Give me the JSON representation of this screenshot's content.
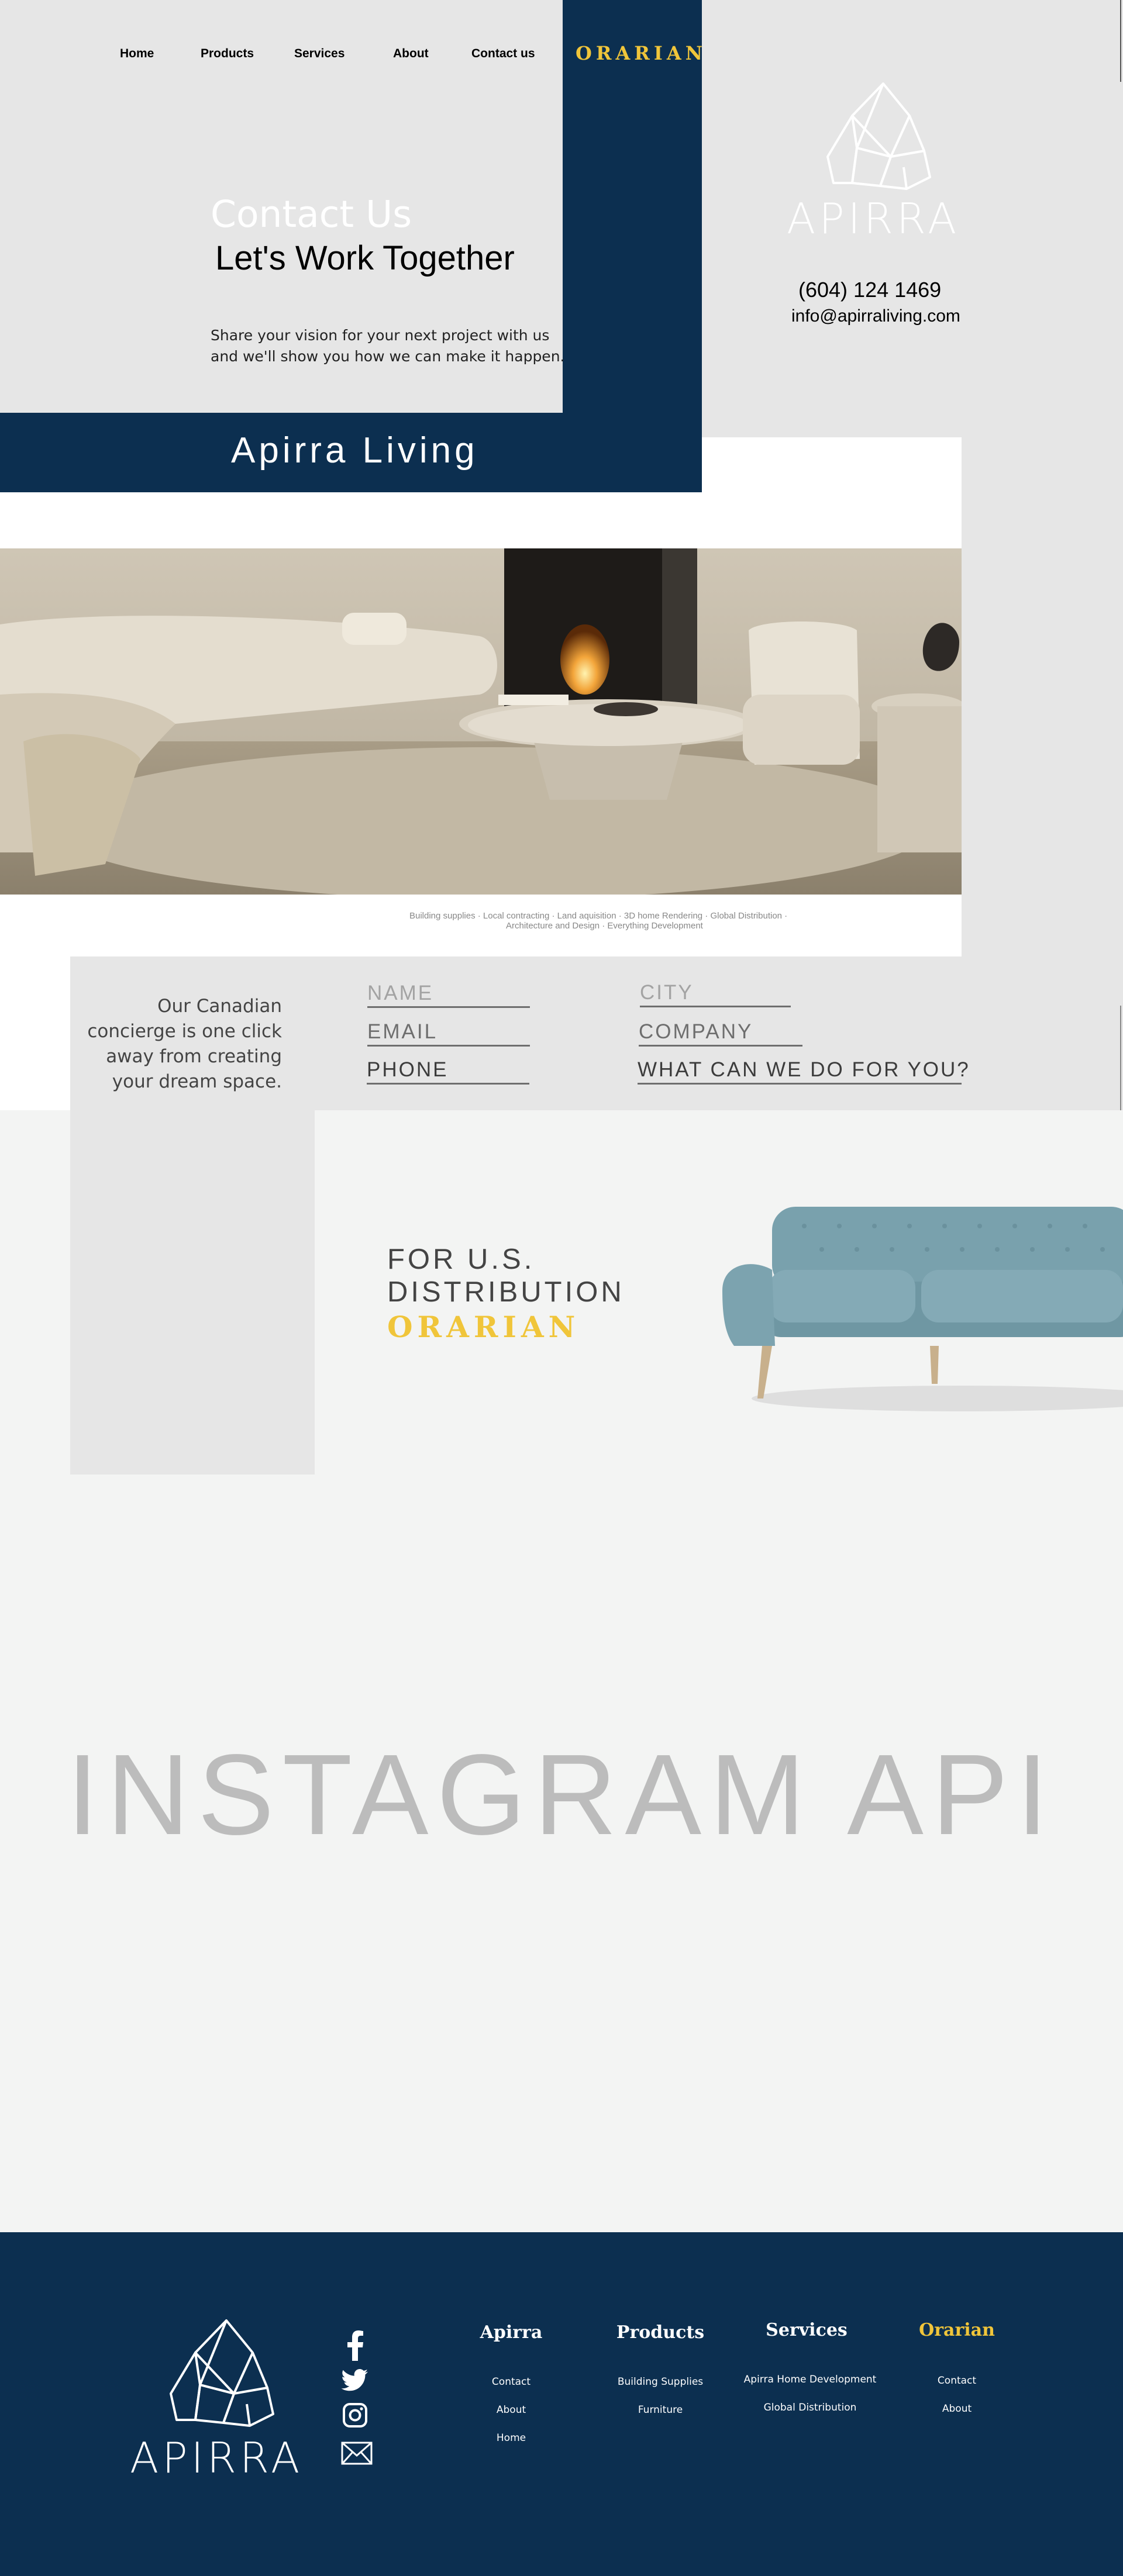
{
  "nav": {
    "items": [
      "Home",
      "Products",
      "Services",
      "About",
      "Contact us"
    ],
    "brand": "ORARIAN"
  },
  "logo": {
    "text": "APIRRA"
  },
  "hero": {
    "eyebrow": "Contact Us",
    "title": "Let's Work Together",
    "subtitle_line1": "Share your vision for your next project with us",
    "subtitle_line2": "and we'll show you how we can make it happen.",
    "band_title": "Apirra Living"
  },
  "contact": {
    "phone": "(604) 124 1469",
    "email": "info@apirraliving.com"
  },
  "services_caption": {
    "line1": "Building supplies · Local contracting · Land aquisition · 3D home Rendering · Global Distribution ·",
    "line2": "Architecture and Design · Everything Development"
  },
  "concierge": {
    "line1": "Our Canadian",
    "line2": "concierge is one click",
    "line3": "away from creating",
    "line4": "your dream space."
  },
  "form": {
    "name": "NAME",
    "city": "CITY",
    "email": "EMAIL",
    "company": "COMPANY",
    "phone": "PHONE",
    "what": "WHAT CAN WE DO FOR YOU?"
  },
  "distribution": {
    "line1": "FOR U.S.",
    "line2": "DISTRIBUTION",
    "brand": "ORARIAN"
  },
  "instagram": {
    "text": "INSTAGRAM API"
  },
  "footer": {
    "columns": [
      {
        "heading": "Apirra",
        "links": [
          "Contact",
          "About",
          "Home"
        ]
      },
      {
        "heading": "Products",
        "links": [
          "Building Supplies",
          "Furniture"
        ]
      },
      {
        "heading": "Services",
        "links": [
          "Apirra Home Development",
          "Global Distribution"
        ]
      },
      {
        "heading": "Orarian",
        "links": [
          "Contact",
          "About"
        ]
      }
    ]
  },
  "colors": {
    "navy": "#0c2f50",
    "gold": "#f0c53a",
    "light_gray": "#e6e6e6",
    "off_white": "#f3f4f3"
  },
  "icons": [
    "facebook-icon",
    "twitter-icon",
    "instagram-icon",
    "mail-icon"
  ]
}
